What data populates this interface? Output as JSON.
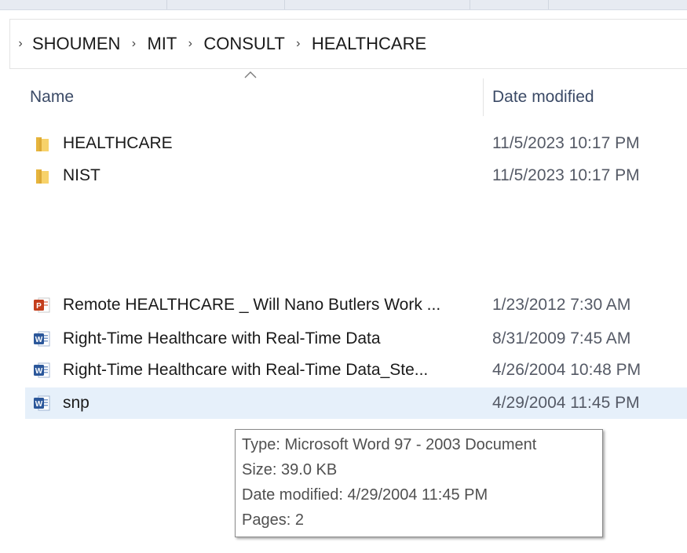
{
  "breadcrumb": {
    "items": [
      "SHOUMEN",
      "MIT",
      "CONSULT",
      "HEALTHCARE"
    ]
  },
  "columns": {
    "name": "Name",
    "date_modified": "Date modified"
  },
  "files": [
    {
      "icon": "folder-icon",
      "name": "HEALTHCARE",
      "date": "11/5/2023 10:17 PM",
      "selected": false
    },
    {
      "icon": "folder-icon",
      "name": "NIST",
      "date": "11/5/2023 10:17 PM",
      "selected": false
    },
    {
      "icon": "powerpoint-file-icon",
      "name": "Remote HEALTHCARE _ Will Nano Butlers Work ...",
      "date": "1/23/2012 7:30 AM",
      "selected": false
    },
    {
      "icon": "word-file-icon",
      "name": "Right-Time Healthcare with Real-Time Data",
      "date": "8/31/2009 7:45 AM",
      "selected": false
    },
    {
      "icon": "word-file-icon",
      "name": "Right-Time Healthcare with Real-Time Data_Ste...",
      "date": "4/26/2004 10:48 PM",
      "selected": false
    },
    {
      "icon": "word-file-icon",
      "name": "snp",
      "date": "4/29/2004 11:45 PM",
      "selected": true
    }
  ],
  "tooltip": {
    "type": "Type: Microsoft Word 97 - 2003 Document",
    "size": "Size: 39.0 KB",
    "date_modified": "Date modified: 4/29/2004 11:45 PM",
    "pages": "Pages: 2"
  },
  "colors": {
    "selection": "#e6f0fa",
    "folder": "#f2c94c",
    "word": "#2b579a",
    "powerpoint": "#c43e1c"
  }
}
